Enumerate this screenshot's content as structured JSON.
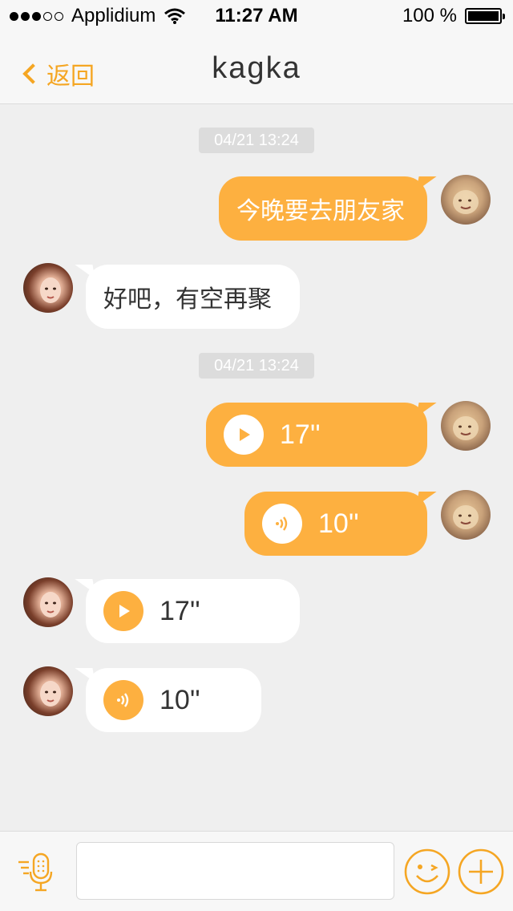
{
  "status_bar": {
    "carrier": "Applidium",
    "time": "11:27 AM",
    "battery": "100 %",
    "signal_dots_filled": 3,
    "signal_dots_total": 5,
    "wifi_icon": "wifi-icon",
    "battery_level": 1.0
  },
  "nav": {
    "back_label": "返回",
    "title": "kagka"
  },
  "messages": [
    {
      "type": "timestamp",
      "text": "04/21 13:24"
    },
    {
      "type": "text",
      "direction": "out",
      "text": "今晚要去朋友家"
    },
    {
      "type": "text",
      "direction": "in",
      "text": "好吧，有空再聚"
    },
    {
      "type": "timestamp",
      "text": "04/21 13:24"
    },
    {
      "type": "voice",
      "direction": "out",
      "icon": "play-icon",
      "duration": "17''"
    },
    {
      "type": "voice",
      "direction": "out",
      "icon": "sound-wave-icon",
      "duration": "10''"
    },
    {
      "type": "voice",
      "direction": "in",
      "icon": "play-icon",
      "duration": "17''"
    },
    {
      "type": "voice",
      "direction": "in",
      "icon": "sound-wave-icon",
      "duration": "10''"
    }
  ],
  "input_bar": {
    "mic_icon": "microphone-icon",
    "input_value": "",
    "emoji_icon": "emoji-icon",
    "plus_icon": "plus-icon"
  },
  "colors": {
    "accent": "#fdb040",
    "nav_accent": "#f5a623",
    "background": "#efefef"
  }
}
